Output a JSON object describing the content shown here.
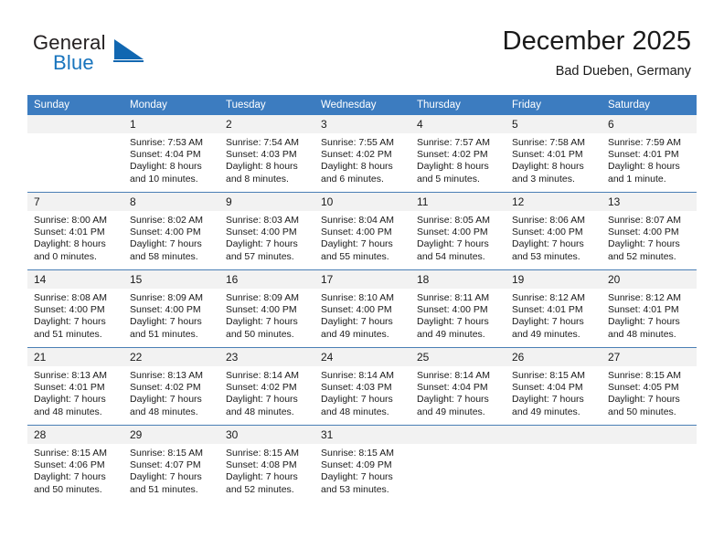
{
  "brand": {
    "name_part1": "General",
    "name_part2": "Blue",
    "logo_icon": "blue-triangle-icon"
  },
  "header": {
    "title": "December 2025",
    "subtitle": "Bad Dueben, Germany"
  },
  "colors": {
    "header_blue": "#3c7cc0",
    "brand_blue": "#1167b1",
    "daynum_background": "#f2f2f2",
    "row_divider": "#4a7fb5"
  },
  "calendar": {
    "weekday_headers": [
      "Sunday",
      "Monday",
      "Tuesday",
      "Wednesday",
      "Thursday",
      "Friday",
      "Saturday"
    ],
    "weeks": [
      [
        {
          "day": "",
          "empty": true,
          "sunrise": "",
          "sunset": "",
          "daylight_line1": "",
          "daylight_line2": ""
        },
        {
          "day": "1",
          "sunrise": "Sunrise: 7:53 AM",
          "sunset": "Sunset: 4:04 PM",
          "daylight_line1": "Daylight: 8 hours",
          "daylight_line2": "and 10 minutes."
        },
        {
          "day": "2",
          "sunrise": "Sunrise: 7:54 AM",
          "sunset": "Sunset: 4:03 PM",
          "daylight_line1": "Daylight: 8 hours",
          "daylight_line2": "and 8 minutes."
        },
        {
          "day": "3",
          "sunrise": "Sunrise: 7:55 AM",
          "sunset": "Sunset: 4:02 PM",
          "daylight_line1": "Daylight: 8 hours",
          "daylight_line2": "and 6 minutes."
        },
        {
          "day": "4",
          "sunrise": "Sunrise: 7:57 AM",
          "sunset": "Sunset: 4:02 PM",
          "daylight_line1": "Daylight: 8 hours",
          "daylight_line2": "and 5 minutes."
        },
        {
          "day": "5",
          "sunrise": "Sunrise: 7:58 AM",
          "sunset": "Sunset: 4:01 PM",
          "daylight_line1": "Daylight: 8 hours",
          "daylight_line2": "and 3 minutes."
        },
        {
          "day": "6",
          "sunrise": "Sunrise: 7:59 AM",
          "sunset": "Sunset: 4:01 PM",
          "daylight_line1": "Daylight: 8 hours",
          "daylight_line2": "and 1 minute."
        }
      ],
      [
        {
          "day": "7",
          "sunrise": "Sunrise: 8:00 AM",
          "sunset": "Sunset: 4:01 PM",
          "daylight_line1": "Daylight: 8 hours",
          "daylight_line2": "and 0 minutes."
        },
        {
          "day": "8",
          "sunrise": "Sunrise: 8:02 AM",
          "sunset": "Sunset: 4:00 PM",
          "daylight_line1": "Daylight: 7 hours",
          "daylight_line2": "and 58 minutes."
        },
        {
          "day": "9",
          "sunrise": "Sunrise: 8:03 AM",
          "sunset": "Sunset: 4:00 PM",
          "daylight_line1": "Daylight: 7 hours",
          "daylight_line2": "and 57 minutes."
        },
        {
          "day": "10",
          "sunrise": "Sunrise: 8:04 AM",
          "sunset": "Sunset: 4:00 PM",
          "daylight_line1": "Daylight: 7 hours",
          "daylight_line2": "and 55 minutes."
        },
        {
          "day": "11",
          "sunrise": "Sunrise: 8:05 AM",
          "sunset": "Sunset: 4:00 PM",
          "daylight_line1": "Daylight: 7 hours",
          "daylight_line2": "and 54 minutes."
        },
        {
          "day": "12",
          "sunrise": "Sunrise: 8:06 AM",
          "sunset": "Sunset: 4:00 PM",
          "daylight_line1": "Daylight: 7 hours",
          "daylight_line2": "and 53 minutes."
        },
        {
          "day": "13",
          "sunrise": "Sunrise: 8:07 AM",
          "sunset": "Sunset: 4:00 PM",
          "daylight_line1": "Daylight: 7 hours",
          "daylight_line2": "and 52 minutes."
        }
      ],
      [
        {
          "day": "14",
          "sunrise": "Sunrise: 8:08 AM",
          "sunset": "Sunset: 4:00 PM",
          "daylight_line1": "Daylight: 7 hours",
          "daylight_line2": "and 51 minutes."
        },
        {
          "day": "15",
          "sunrise": "Sunrise: 8:09 AM",
          "sunset": "Sunset: 4:00 PM",
          "daylight_line1": "Daylight: 7 hours",
          "daylight_line2": "and 51 minutes."
        },
        {
          "day": "16",
          "sunrise": "Sunrise: 8:09 AM",
          "sunset": "Sunset: 4:00 PM",
          "daylight_line1": "Daylight: 7 hours",
          "daylight_line2": "and 50 minutes."
        },
        {
          "day": "17",
          "sunrise": "Sunrise: 8:10 AM",
          "sunset": "Sunset: 4:00 PM",
          "daylight_line1": "Daylight: 7 hours",
          "daylight_line2": "and 49 minutes."
        },
        {
          "day": "18",
          "sunrise": "Sunrise: 8:11 AM",
          "sunset": "Sunset: 4:00 PM",
          "daylight_line1": "Daylight: 7 hours",
          "daylight_line2": "and 49 minutes."
        },
        {
          "day": "19",
          "sunrise": "Sunrise: 8:12 AM",
          "sunset": "Sunset: 4:01 PM",
          "daylight_line1": "Daylight: 7 hours",
          "daylight_line2": "and 49 minutes."
        },
        {
          "day": "20",
          "sunrise": "Sunrise: 8:12 AM",
          "sunset": "Sunset: 4:01 PM",
          "daylight_line1": "Daylight: 7 hours",
          "daylight_line2": "and 48 minutes."
        }
      ],
      [
        {
          "day": "21",
          "sunrise": "Sunrise: 8:13 AM",
          "sunset": "Sunset: 4:01 PM",
          "daylight_line1": "Daylight: 7 hours",
          "daylight_line2": "and 48 minutes."
        },
        {
          "day": "22",
          "sunrise": "Sunrise: 8:13 AM",
          "sunset": "Sunset: 4:02 PM",
          "daylight_line1": "Daylight: 7 hours",
          "daylight_line2": "and 48 minutes."
        },
        {
          "day": "23",
          "sunrise": "Sunrise: 8:14 AM",
          "sunset": "Sunset: 4:02 PM",
          "daylight_line1": "Daylight: 7 hours",
          "daylight_line2": "and 48 minutes."
        },
        {
          "day": "24",
          "sunrise": "Sunrise: 8:14 AM",
          "sunset": "Sunset: 4:03 PM",
          "daylight_line1": "Daylight: 7 hours",
          "daylight_line2": "and 48 minutes."
        },
        {
          "day": "25",
          "sunrise": "Sunrise: 8:14 AM",
          "sunset": "Sunset: 4:04 PM",
          "daylight_line1": "Daylight: 7 hours",
          "daylight_line2": "and 49 minutes."
        },
        {
          "day": "26",
          "sunrise": "Sunrise: 8:15 AM",
          "sunset": "Sunset: 4:04 PM",
          "daylight_line1": "Daylight: 7 hours",
          "daylight_line2": "and 49 minutes."
        },
        {
          "day": "27",
          "sunrise": "Sunrise: 8:15 AM",
          "sunset": "Sunset: 4:05 PM",
          "daylight_line1": "Daylight: 7 hours",
          "daylight_line2": "and 50 minutes."
        }
      ],
      [
        {
          "day": "28",
          "sunrise": "Sunrise: 8:15 AM",
          "sunset": "Sunset: 4:06 PM",
          "daylight_line1": "Daylight: 7 hours",
          "daylight_line2": "and 50 minutes."
        },
        {
          "day": "29",
          "sunrise": "Sunrise: 8:15 AM",
          "sunset": "Sunset: 4:07 PM",
          "daylight_line1": "Daylight: 7 hours",
          "daylight_line2": "and 51 minutes."
        },
        {
          "day": "30",
          "sunrise": "Sunrise: 8:15 AM",
          "sunset": "Sunset: 4:08 PM",
          "daylight_line1": "Daylight: 7 hours",
          "daylight_line2": "and 52 minutes."
        },
        {
          "day": "31",
          "sunrise": "Sunrise: 8:15 AM",
          "sunset": "Sunset: 4:09 PM",
          "daylight_line1": "Daylight: 7 hours",
          "daylight_line2": "and 53 minutes."
        },
        {
          "day": "",
          "empty": true,
          "sunrise": "",
          "sunset": "",
          "daylight_line1": "",
          "daylight_line2": ""
        },
        {
          "day": "",
          "empty": true,
          "sunrise": "",
          "sunset": "",
          "daylight_line1": "",
          "daylight_line2": ""
        },
        {
          "day": "",
          "empty": true,
          "sunrise": "",
          "sunset": "",
          "daylight_line1": "",
          "daylight_line2": ""
        }
      ]
    ]
  }
}
